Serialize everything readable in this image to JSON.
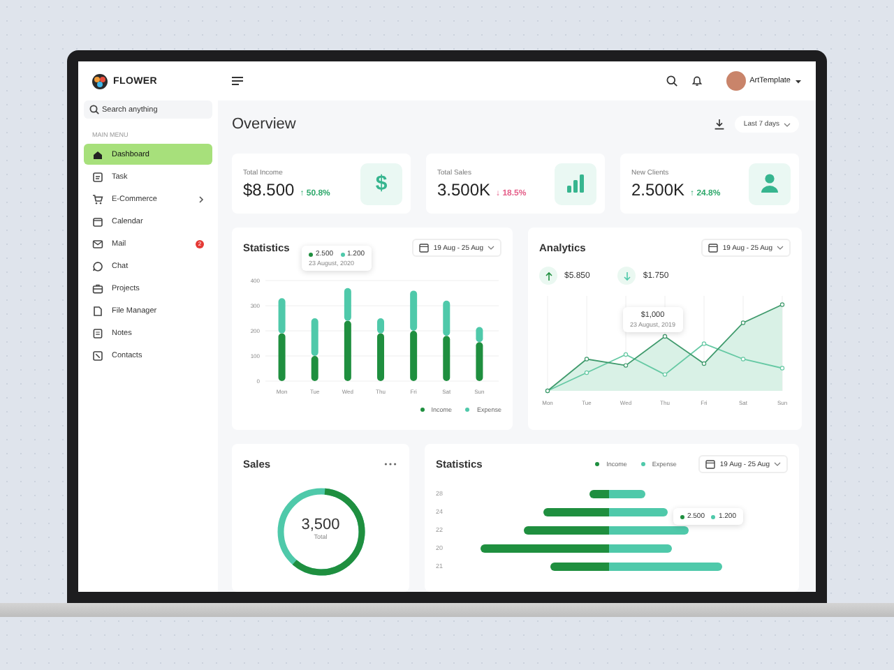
{
  "brand": {
    "name": "FLOWER"
  },
  "sidebar": {
    "search": {
      "placeholder": "Search anything"
    },
    "section_label": "MAIN MENU",
    "items": [
      {
        "label": "Dashboard",
        "selected": true
      },
      {
        "label": "Task",
        "selected": false
      },
      {
        "label": "E-Commerce",
        "selected": false,
        "submenu": true
      },
      {
        "label": "Calendar",
        "selected": false
      },
      {
        "label": "Mail",
        "selected": false,
        "badge": "2"
      },
      {
        "label": "Chat",
        "selected": false
      },
      {
        "label": "Projects",
        "selected": false
      },
      {
        "label": "File Manager",
        "selected": false
      },
      {
        "label": "Notes",
        "selected": false
      },
      {
        "label": "Contacts",
        "selected": false
      }
    ]
  },
  "topbar": {
    "user": {
      "name": "ArtTemplate"
    }
  },
  "overview": {
    "title": "Overview",
    "period": "Last 7 days"
  },
  "stats": [
    {
      "label": "Total Income",
      "value": "$8.500",
      "change": "↑ 50.8%",
      "color": "#2ea86b",
      "symbol": "$"
    },
    {
      "label": "Total Sales",
      "value": "3.500K",
      "change": "↓ 18.5%",
      "color": "#e5608a"
    },
    {
      "label": "New Clients",
      "value": "2.500K",
      "change": "↑ 24.8%",
      "color": "#2ea86b"
    }
  ],
  "statistics": {
    "title": "Statistics",
    "date_range": "19 Aug - 25 Aug",
    "tooltip": {
      "income": "2.500",
      "expense": "1.200",
      "date": "23 August, 2020"
    },
    "chart_data": {
      "type": "bar",
      "stacked": true,
      "grid": true,
      "categories": [
        "Mon",
        "Tue",
        "Wed",
        "Thu",
        "Fri",
        "Sat",
        "Sun"
      ],
      "ylim": [
        0,
        400
      ],
      "yticks": [
        0,
        100,
        200,
        300,
        400
      ],
      "series": [
        {
          "name": "Income",
          "color": "#1f8f3f",
          "values": [
            190,
            100,
            240,
            190,
            200,
            180,
            155
          ]
        },
        {
          "name": "Expense",
          "color": "#4fc9aa",
          "values": [
            140,
            150,
            130,
            60,
            160,
            140,
            60
          ]
        }
      ]
    }
  },
  "analytics": {
    "title": "Analytics",
    "date_range": "19 Aug - 25 Aug",
    "income": "$5.850",
    "expense": "$1.750",
    "tooltip": {
      "value": "$1,000",
      "date": "23 August, 2019"
    },
    "x_labels": [
      "Mon",
      "Tue",
      "Wed",
      "Thu",
      "Fri",
      "Sat",
      "Sun"
    ]
  },
  "sales": {
    "title": "Sales",
    "total": "3,500",
    "total_label": "Total"
  },
  "sales_statistics": {
    "title": "Statistics",
    "legend": [
      "Income",
      "Expense"
    ],
    "date_range": "19 Aug - 25 Aug",
    "tooltip": {
      "income": "2.500",
      "expense": "1.200"
    },
    "y_labels": [
      "28",
      "24",
      "22",
      "20",
      "21"
    ]
  }
}
